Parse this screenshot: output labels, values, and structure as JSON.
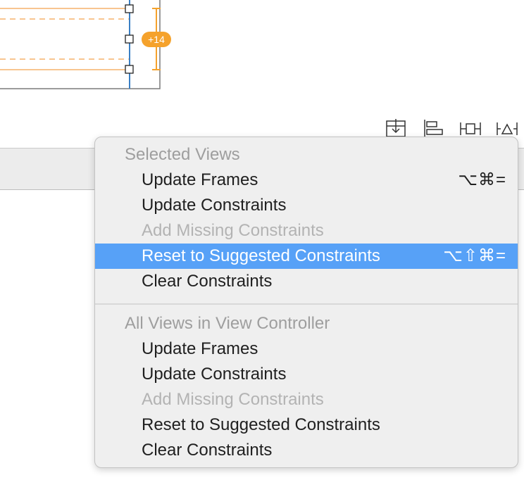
{
  "canvas": {
    "badge": "+14"
  },
  "toolbar": {
    "icons": [
      "embed-in-icon",
      "align-icon",
      "pin-constraints-icon",
      "resolve-auto-layout-icon"
    ]
  },
  "menu": {
    "section1": {
      "header": "Selected Views",
      "items": [
        {
          "label": "Update Frames",
          "shortcut": "⌥⌘="
        },
        {
          "label": "Update Constraints",
          "shortcut": ""
        },
        {
          "label": "Add Missing Constraints",
          "shortcut": ""
        },
        {
          "label": "Reset to Suggested Constraints",
          "shortcut": "⌥⇧⌘="
        },
        {
          "label": "Clear Constraints",
          "shortcut": ""
        }
      ]
    },
    "section2": {
      "header": "All Views in View Controller",
      "items": [
        {
          "label": "Update Frames"
        },
        {
          "label": "Update Constraints"
        },
        {
          "label": "Add Missing Constraints"
        },
        {
          "label": "Reset to Suggested Constraints"
        },
        {
          "label": "Clear Constraints"
        }
      ]
    }
  },
  "colors": {
    "highlight": "#57a1f7",
    "constraint_orange": "#f5a22c",
    "selection_blue": "#3a7fc4"
  }
}
